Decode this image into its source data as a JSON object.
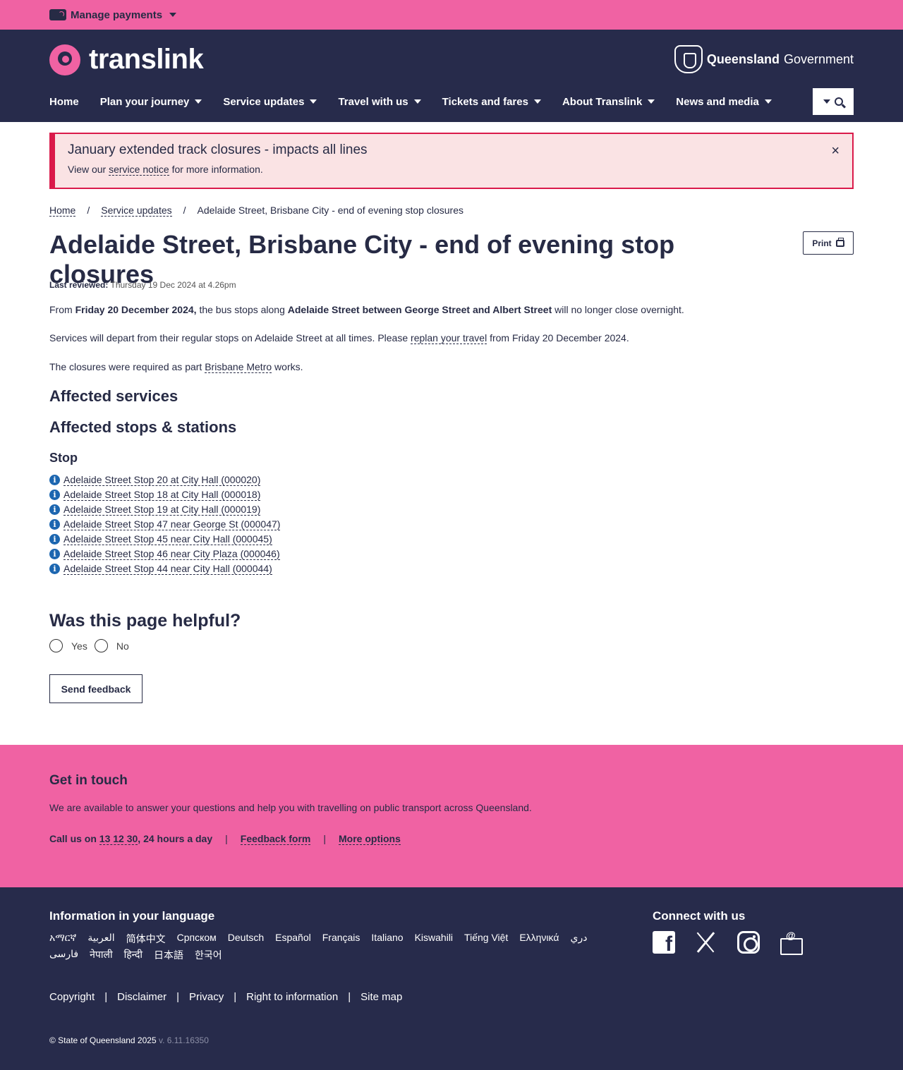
{
  "topbar": {
    "manage_payments": "Manage payments"
  },
  "header": {
    "logo_text": "translink",
    "gov_bold": "Queensland",
    "gov_normal": "Government",
    "nav": [
      {
        "label": "Home",
        "dropdown": false
      },
      {
        "label": "Plan your journey",
        "dropdown": true
      },
      {
        "label": "Service updates",
        "dropdown": true
      },
      {
        "label": "Travel with us",
        "dropdown": true
      },
      {
        "label": "Tickets and fares",
        "dropdown": true
      },
      {
        "label": "About Translink",
        "dropdown": true
      },
      {
        "label": "News and media",
        "dropdown": true
      }
    ]
  },
  "alert": {
    "title": "January extended track closures - impacts all lines",
    "text_before": "View our ",
    "link": "service notice",
    "text_after": " for more information.",
    "close": "×"
  },
  "breadcrumb": [
    "Home",
    "Service updates",
    "Adelaide Street, Brisbane City - end of evening stop closures"
  ],
  "page": {
    "title": "Adelaide Street, Brisbane City - end of evening stop closures",
    "print": "Print",
    "reviewed_label": "Last reviewed:",
    "reviewed_value": " Thursday 19 Dec 2024 at 4.26pm",
    "p1": {
      "a": "From ",
      "b": "Friday 20 December 2024,",
      "c": " the bus stops along ",
      "d": "Adelaide Street between George Street and Albert Street",
      "e": " will no longer close overnight."
    },
    "p2": {
      "a": "Services will depart from their regular stops on Adelaide Street at all times. Please ",
      "link": "replan your travel",
      "b": " from Friday 20 December 2024."
    },
    "p3": {
      "a": "The closures were required as part ",
      "link": "Brisbane Metro",
      "b": " works."
    },
    "affected_services": "Affected services",
    "affected_stops": "Affected stops & stations",
    "stop_heading": "Stop",
    "stops": [
      "Adelaide Street Stop 20 at City Hall (000020)",
      "Adelaide Street Stop 18 at City Hall (000018)",
      "Adelaide Street Stop 19 at City Hall (000019)",
      "Adelaide Street Stop 47 near George St (000047)",
      "Adelaide Street Stop 45 near City Hall (000045)",
      "Adelaide Street Stop 46 near City Plaza (000046)",
      "Adelaide Street Stop 44 near City Hall (000044)"
    ],
    "helpful_q": "Was this page helpful?",
    "yes": "Yes",
    "no": "No",
    "send_feedback": "Send feedback"
  },
  "touch": {
    "heading": "Get in touch",
    "text": "We are available to answer your questions and help you with travelling on public transport across Queensland.",
    "call_prefix": "Call us on ",
    "call_number": "13 12 30",
    "call_suffix": ", 24 hours a day",
    "feedback": "Feedback form",
    "more": "More options"
  },
  "footer": {
    "lang_heading": "Information in your language",
    "languages": [
      "አማርኛ",
      "العربية",
      "简体中文",
      "Српском",
      "Deutsch",
      "Español",
      "Français",
      "Italiano",
      "Kiswahili",
      "Tiếng Việt",
      "Ελληνικά",
      "دري",
      "فارسی",
      "नेपाली",
      "हिन्दी",
      "日本語",
      "한국어"
    ],
    "connect_heading": "Connect with us",
    "legal": [
      "Copyright",
      "Disclaimer",
      "Privacy",
      "Right to information",
      "Site map"
    ],
    "copyright": "© State of Queensland 2025",
    "version": " v. 6.11.16350"
  },
  "colors": {
    "pink": "#f062a3",
    "navy": "#272b4b",
    "alert_red": "#da1a4a",
    "info_blue": "#1c66b0"
  }
}
